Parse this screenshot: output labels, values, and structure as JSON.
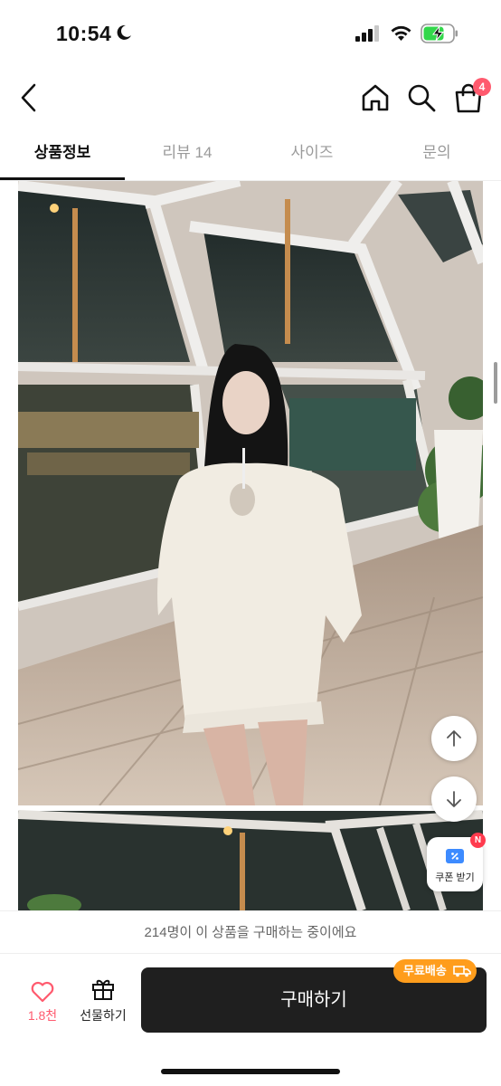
{
  "status_bar": {
    "time": "10:54",
    "icons": [
      "moon-icon",
      "cellular-signal-icon",
      "wifi-icon",
      "battery-charging-icon"
    ],
    "battery_color": "#32d74b"
  },
  "nav": {
    "icons": [
      "back-chevron-icon",
      "home-icon",
      "search-icon",
      "shopping-bag-icon"
    ],
    "cart_badge": "4",
    "badge_color": "#ff5a6e"
  },
  "tabs": [
    {
      "label": "상품정보",
      "active": true
    },
    {
      "label": "리뷰 14",
      "active": false
    },
    {
      "label": "사이즈",
      "active": false
    },
    {
      "label": "문의",
      "active": false
    }
  ],
  "product_image": {
    "description_icon": "product-photo"
  },
  "floating": {
    "scroll_up_icon": "arrow-up-icon",
    "scroll_down_icon": "arrow-down-icon",
    "coupon_label": "쿠폰 받기",
    "coupon_badge": "N"
  },
  "bottom": {
    "notice": "214명이 이 상품을 구매하는 중이에요",
    "like_count": "1.8천",
    "gift_label": "선물하기",
    "buy_label": "구매하기",
    "free_shipping_label": "무료배송",
    "accent_color": "#ff9d1c"
  }
}
